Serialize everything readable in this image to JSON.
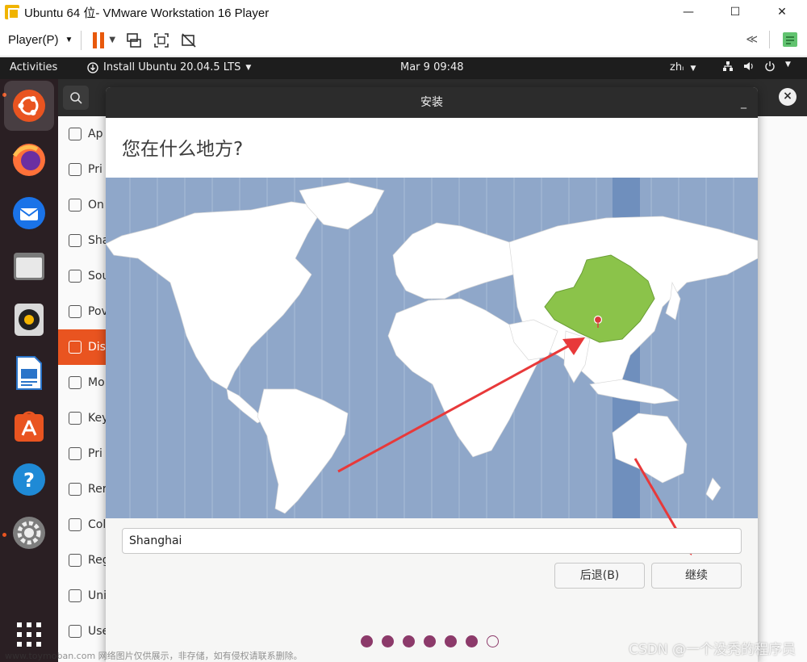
{
  "vmware": {
    "title": "Ubuntu 64 位- VMware Workstation 16 Player",
    "player_menu": "Player(P)",
    "window_controls": {
      "minimize": "—",
      "maximize": "☐",
      "close": "✕"
    }
  },
  "topbar": {
    "activities": "Activities",
    "app_menu": "Install Ubuntu 20.04.5 LTS",
    "clock": "Mar 9  09:48",
    "lang": "zh"
  },
  "dock": {
    "items": [
      "ubuntu-installer",
      "firefox",
      "thunderbird",
      "files",
      "rhythmbox",
      "libreoffice-writer",
      "ubuntu-software",
      "help",
      "settings",
      "show-applications"
    ]
  },
  "settings": {
    "items": [
      {
        "label": "Ap",
        "icon": "grid-icon"
      },
      {
        "label": "Pri",
        "icon": "lock-icon"
      },
      {
        "label": "On",
        "icon": "cloud-icon"
      },
      {
        "label": "Sha",
        "icon": "share-icon"
      },
      {
        "label": "Sou",
        "icon": "music-note-icon"
      },
      {
        "label": "Pov",
        "icon": "power-icon"
      },
      {
        "label": "Dis",
        "icon": "display-icon",
        "selected": true
      },
      {
        "label": "Mo",
        "icon": "mouse-icon"
      },
      {
        "label": "Key",
        "icon": "keyboard-icon"
      },
      {
        "label": "Pri",
        "icon": "printer-icon"
      },
      {
        "label": "Rer",
        "icon": "removable-media-icon"
      },
      {
        "label": "Col",
        "icon": "color-icon"
      },
      {
        "label": "Reg",
        "icon": "globe-icon"
      },
      {
        "label": "Uni",
        "icon": "accessibility-icon"
      },
      {
        "label": "Use",
        "icon": "users-icon"
      }
    ]
  },
  "installer": {
    "window_title": "安装",
    "minimize": "_",
    "heading": "您在什么地方?",
    "location_value": "Shanghai",
    "back_button": "后退(B)",
    "continue_button": "继续",
    "progress": {
      "total": 7,
      "completed": 6
    }
  },
  "watermark": "www.toymoban.com 网络图片仅供展示，非存储，如有侵权请联系删除。",
  "csdn_watermark": "CSDN @一个没秃的程序员",
  "colors": {
    "ubuntu_orange": "#e95420",
    "aubergine": "#8c3a6a",
    "map_ocean": "#8fa7c9",
    "highlight_country": "#8bc34a",
    "annotation_arrow": "#e8393a"
  }
}
